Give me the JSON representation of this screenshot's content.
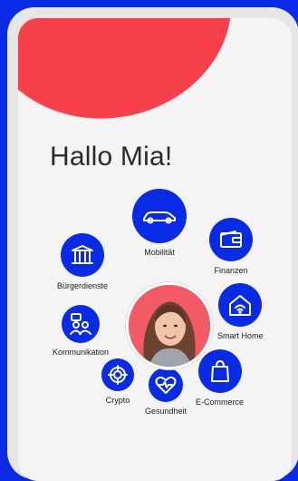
{
  "greeting": "Hallo Mia!",
  "services": [
    {
      "label": "Mobilität",
      "icon": "car-icon"
    },
    {
      "label": "Finanzen",
      "icon": "wallet-icon"
    },
    {
      "label": "Smart Home",
      "icon": "smart-home-icon"
    },
    {
      "label": "E-Commerce",
      "icon": "shopping-bag-icon"
    },
    {
      "label": "Gesundheit",
      "icon": "heart-pulse-icon"
    },
    {
      "label": "Crypto",
      "icon": "crypto-icon"
    },
    {
      "label": "Kommunikation",
      "icon": "people-chat-icon"
    },
    {
      "label": "Bürgerdienste",
      "icon": "government-building-icon"
    }
  ],
  "colors": {
    "brand": "#0a2be6",
    "accent": "#f8404b",
    "background": "#f4f4f4"
  }
}
